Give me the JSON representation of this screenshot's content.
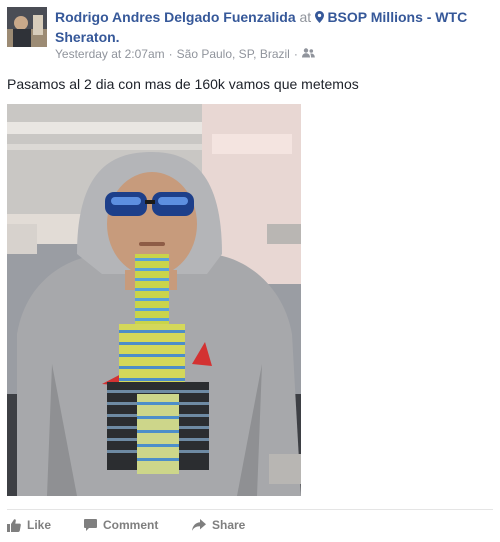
{
  "post": {
    "author": "Rodrigo Andres Delgado Fuenzalida",
    "at_text": "at",
    "location": "BSOP Millions - WTC Sheraton.",
    "timestamp": "Yesterday at 2:07am",
    "separator": "·",
    "city": "São Paulo, SP, Brazil",
    "audience_icon": "friends-icon",
    "text": "Pasamos al 2 dia con mas de 160k vamos que metemos"
  },
  "actions": {
    "like_label": "Like",
    "comment_label": "Comment",
    "share_label": "Share"
  },
  "colors": {
    "link": "#365899",
    "meta": "#90949c",
    "text": "#1d2129",
    "action": "#7f7f7f"
  }
}
